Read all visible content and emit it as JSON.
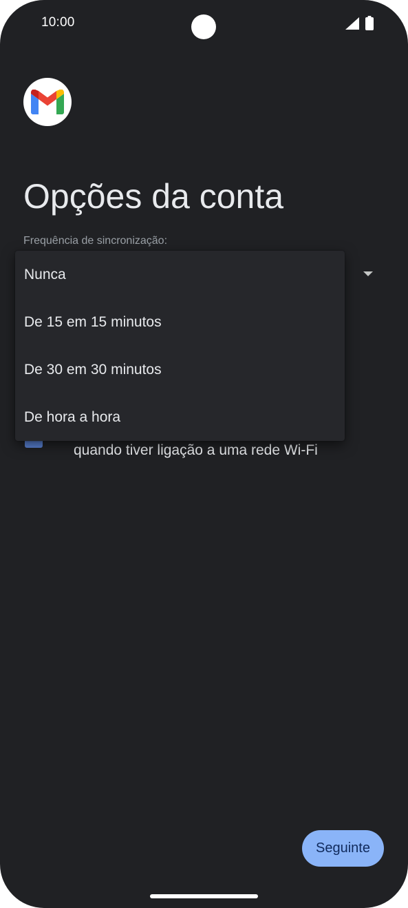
{
  "status_bar": {
    "time": "10:00",
    "signal_icon": "signal-icon",
    "battery_icon": "battery-icon"
  },
  "app": {
    "logo_icon": "gmail-logo-icon"
  },
  "page": {
    "title": "Opções da conta",
    "sync_label": "Frequência de sincronização:",
    "sync_selected": "Nunca",
    "wifi_text": "quando tiver ligação a uma rede Wi-Fi"
  },
  "menu": {
    "items": [
      {
        "label": "Nunca"
      },
      {
        "label": "De 15 em 15 minutos"
      },
      {
        "label": "De 30 em 30 minutos"
      },
      {
        "label": "De hora a hora"
      }
    ]
  },
  "footer": {
    "next_label": "Seguinte"
  },
  "colors": {
    "background": "#202124",
    "menu_background": "#26272b",
    "accent": "#8ab4f8",
    "checkbox": "#5b83d6"
  }
}
